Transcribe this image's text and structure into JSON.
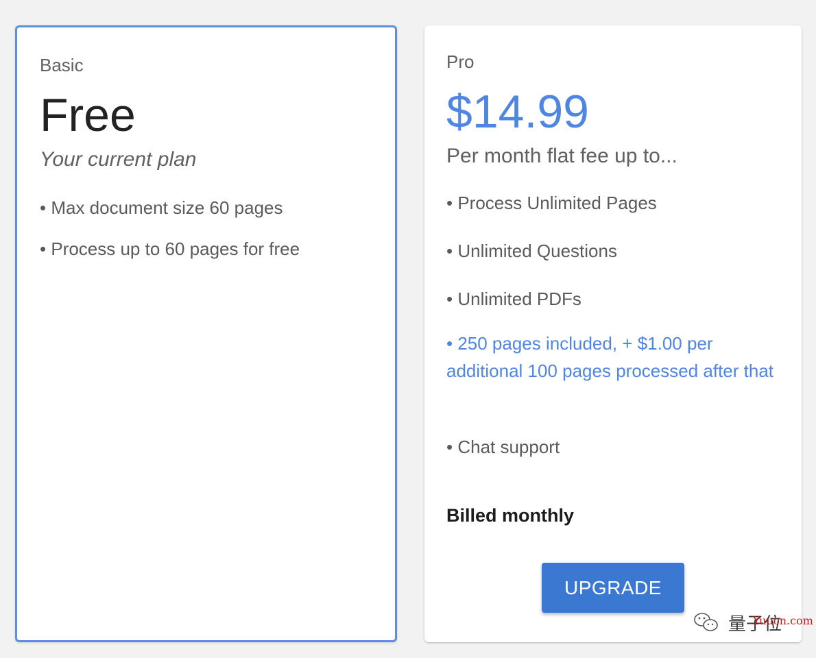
{
  "basic": {
    "name": "Basic",
    "price": "Free",
    "subtitle": "Your current plan",
    "features": [
      "• Max document size 60 pages",
      "• Process up to 60 pages for free"
    ]
  },
  "pro": {
    "name": "Pro",
    "price": "$14.99",
    "subtitle": "Per month flat fee up to...",
    "features": [
      "• Process Unlimited Pages",
      "• Unlimited Questions",
      "• Unlimited PDFs",
      "• 250 pages included, + $1.00 per additional 100 pages processed after that",
      "• Chat support"
    ],
    "billing": "Billed monthly",
    "upgrade_label": "UPGRADE"
  },
  "colors": {
    "accent": "#4f86e4",
    "button": "#3b78d2",
    "selected_border": "#5b8de2"
  },
  "watermark": {
    "icon": "wechat-icon",
    "text": "量子位",
    "site": "Yuucn.com"
  }
}
